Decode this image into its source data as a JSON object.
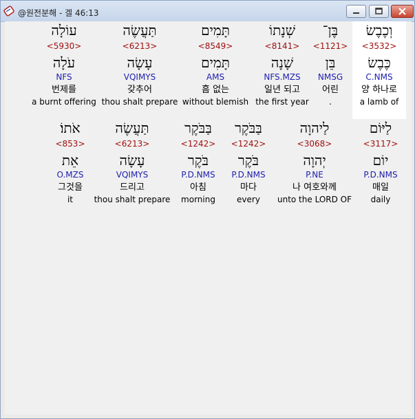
{
  "window": {
    "title": "@원전분해 - 겔 46:13"
  },
  "row1": [
    {
      "heb": "עוֹלָה",
      "strong": "<5930>",
      "lemma": "עֹלָה",
      "morph": "NFS",
      "kor": "번제를",
      "eng": "a burnt offering"
    },
    {
      "heb": "תַּעֲשֶׂה",
      "strong": "<6213>",
      "lemma": "עָשָׂה",
      "morph": "VQIMYS",
      "kor": "갖추어",
      "eng": "thou shalt prepare"
    },
    {
      "heb": "תָּמִים",
      "strong": "<8549>",
      "lemma": "תָּמִים",
      "morph": "AMS",
      "kor": "흠 없는",
      "eng": "without blemish"
    },
    {
      "heb": "שְׁנָתוֹ",
      "strong": "<8141>",
      "lemma": "שָׁנָה",
      "morph": "NFS.MZS",
      "kor": "일년 되고",
      "eng": "the first year"
    },
    {
      "heb": "בֶּן־",
      "strong": "<1121>",
      "lemma": "בֵּן",
      "morph": "NMSG",
      "kor": "어린",
      "eng": "."
    },
    {
      "heb": "וְכֶבֶשׂ",
      "strong": "<3532>",
      "lemma": "כֶּבֶשׂ",
      "morph": "C.NMS",
      "kor": "양 하나로",
      "eng": "a lamb of"
    }
  ],
  "row2": [
    {
      "heb": "אֹתוֹ׃",
      "strong": "<853>",
      "lemma": "אֵת",
      "morph": "O.MZS",
      "kor": "그것을",
      "eng": "it"
    },
    {
      "heb": "תַּעֲשֶׂה",
      "strong": "<6213>",
      "lemma": "עָשָׂה",
      "morph": "VQIMYS",
      "kor": "드리고",
      "eng": "thou shalt prepare"
    },
    {
      "heb": "בַּבֹּקֶר",
      "strong": "<1242>",
      "lemma": "בֹּקֶר",
      "morph": "P.D.NMS",
      "kor": "아침",
      "eng": "morning"
    },
    {
      "heb": "בַּבֹּקֶר",
      "strong": "<1242>",
      "lemma": "בֹּקֶר",
      "morph": "P.D.NMS",
      "kor": "마다",
      "eng": "every"
    },
    {
      "heb": "לַיהוָה",
      "strong": "<3068>",
      "lemma": "יְהוָה",
      "morph": "P.NE",
      "kor": "나 여호와께",
      "eng": "unto the LORD OF"
    },
    {
      "heb": "לַיּוֹם",
      "strong": "<3117>",
      "lemma": "יוֹם",
      "morph": "P.D.NMS",
      "kor": "매일",
      "eng": "daily"
    }
  ],
  "colors": {
    "strong": "#a01010",
    "morph": "#2020b0",
    "highlight": "#ffffff",
    "background": "#f0f0f0"
  },
  "icons": {
    "app": "scroll-book-icon",
    "minimize": "minimize-icon",
    "maximize": "maximize-icon",
    "close": "close-icon"
  }
}
